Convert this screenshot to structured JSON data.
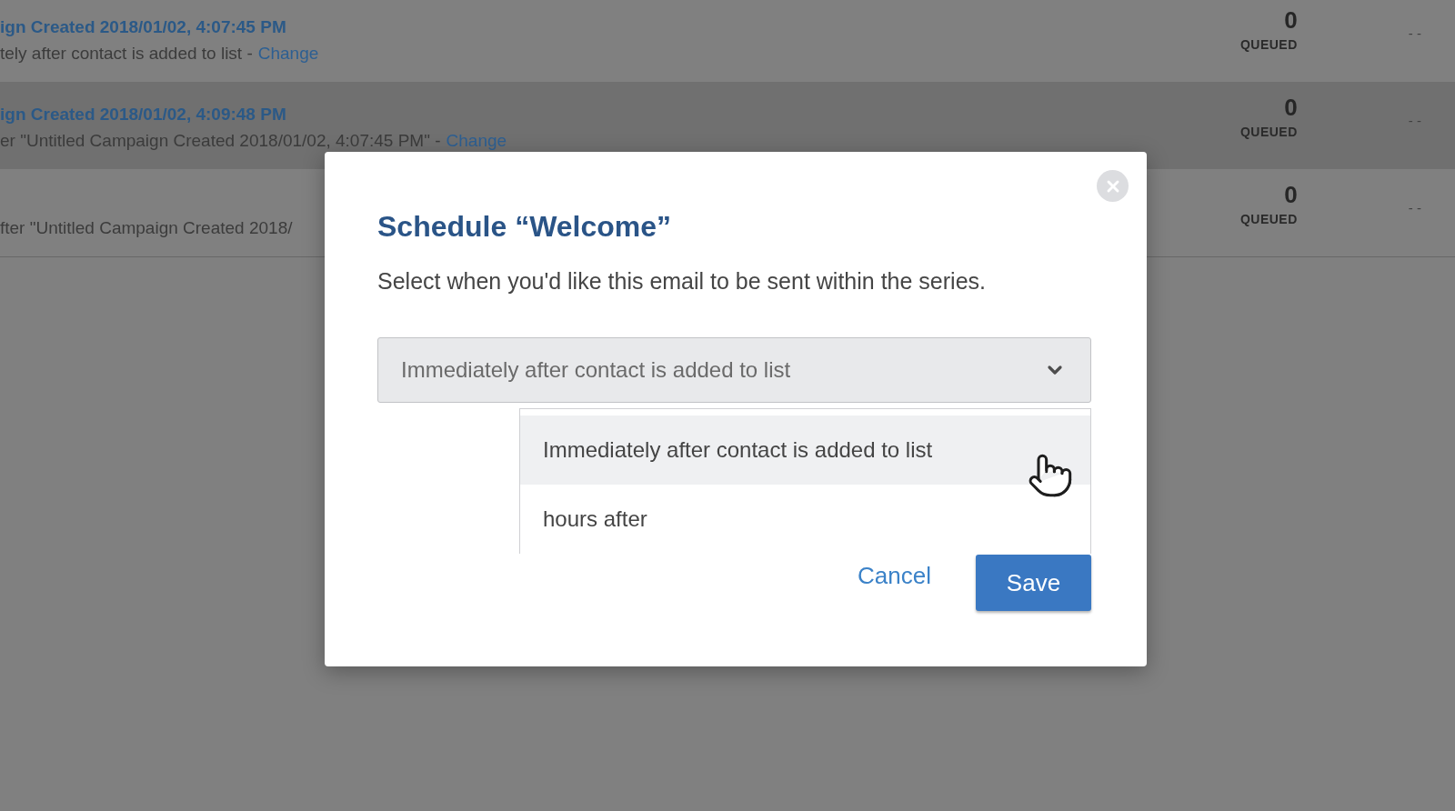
{
  "rows": [
    {
      "title": "ign Created 2018/01/02, 4:07:45 PM",
      "schedule": "tely after contact is added to list -",
      "link": "Change",
      "count": "0",
      "count_label": "QUEUED",
      "column_3": "- -",
      "highlighted": false
    },
    {
      "title": "ign Created 2018/01/02, 4:09:48 PM",
      "schedule": "er \"Untitled Campaign Created 2018/01/02, 4:07:45 PM\" -",
      "link": "Change",
      "count": "0",
      "count_label": "QUEUED",
      "column_3": "- -",
      "highlighted": true
    },
    {
      "schedule": "fter \"Untitled Campaign Created 2018/",
      "count": "0",
      "count_label": "QUEUED",
      "column_3": "- -",
      "highlighted": false
    }
  ],
  "modal": {
    "title": "Schedule “Welcome”",
    "description": "Select when you'd like this email to be sent within the series.",
    "select": {
      "value": "Immediately after contact is added to list",
      "expanded": true,
      "options": [
        {
          "label": "Immediately after contact is added to list",
          "selected": true
        },
        {
          "label": "hours after",
          "selected": false
        }
      ]
    },
    "buttons": [
      {
        "kind": "link",
        "label": "Cancel"
      },
      {
        "kind": "primary",
        "label": "Save"
      }
    ]
  }
}
